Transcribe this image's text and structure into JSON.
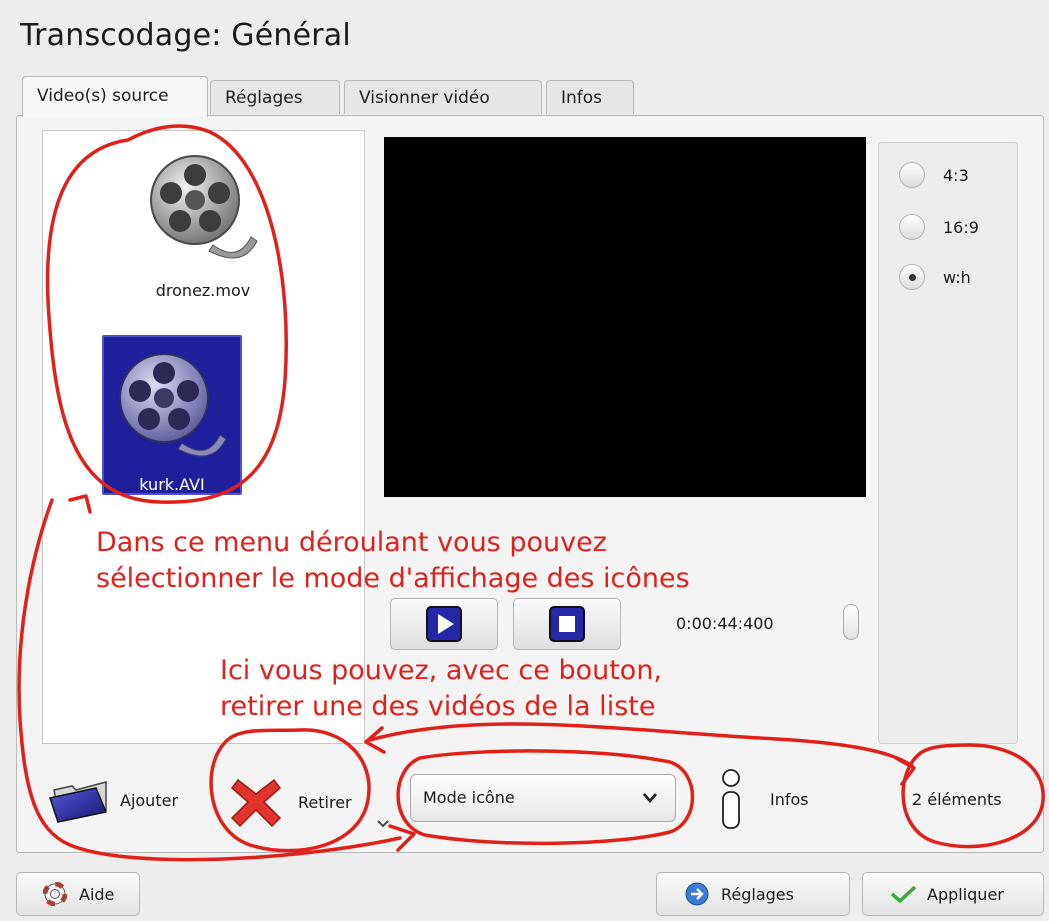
{
  "window": {
    "title": "Transcodage: Général"
  },
  "tabs": [
    {
      "label": "Video(s) source"
    },
    {
      "label": "Réglages"
    },
    {
      "label": "Visionner vidéo"
    },
    {
      "label": "Infos"
    }
  ],
  "files": [
    {
      "name": "dronez.mov",
      "selected": false
    },
    {
      "name": "kurk.AVI",
      "selected": true
    }
  ],
  "aspect_ratio": {
    "options": [
      "4:3",
      "16:9",
      "w:h"
    ],
    "selected": "w:h"
  },
  "player": {
    "time": "0:00:44:400"
  },
  "bottom_bar": {
    "add_label": "Ajouter",
    "remove_label": "Retirer",
    "view_mode": "Mode icône",
    "infos_label": "Infos",
    "count": "2 éléments"
  },
  "footer": {
    "help_label": "Aide",
    "settings_label": "Réglages",
    "apply_label": "Appliquer"
  },
  "annotations": {
    "menu_note_line1": "Dans ce menu déroulant vous pouvez",
    "menu_note_line2": "sélectionner le mode d'affichage des icônes",
    "remove_note_line1": "Ici vous pouvez, avec ce bouton,",
    "remove_note_line2": "retirer  une des vidéos de la liste"
  },
  "colors": {
    "annotation": "#e2201b",
    "selection": "#1f1f9c"
  }
}
